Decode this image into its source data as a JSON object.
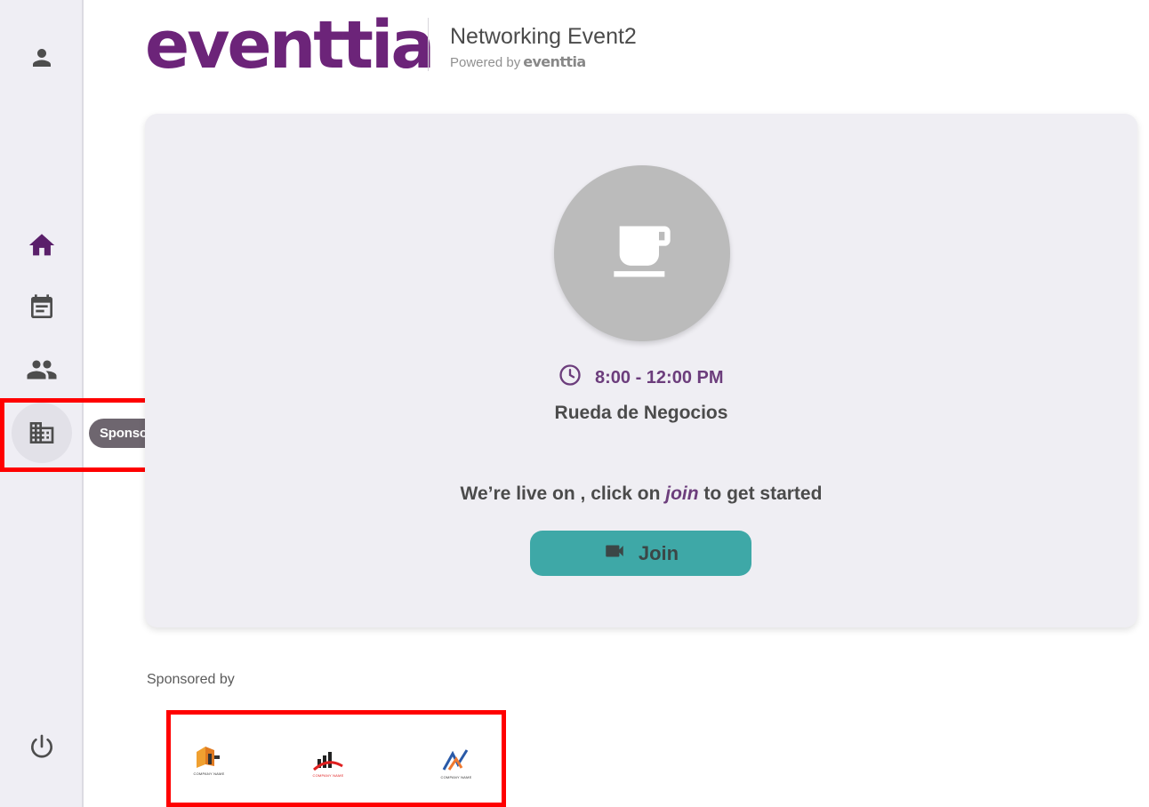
{
  "sidebar": {
    "items": [
      {
        "name": "profile",
        "icon": "person-icon"
      },
      {
        "name": "home",
        "icon": "home-icon"
      },
      {
        "name": "agenda",
        "icon": "calendar-icon"
      },
      {
        "name": "networking",
        "icon": "people-icon"
      },
      {
        "name": "sponsors",
        "icon": "building-icon"
      },
      {
        "name": "logout",
        "icon": "power-icon"
      }
    ],
    "tooltip": "Sponsors"
  },
  "header": {
    "logo_text": "eventtia",
    "event_title": "Networking Event2",
    "powered_by": "Powered by",
    "powered_logo": "eventtia"
  },
  "session": {
    "time": "8:00 - 12:00 PM",
    "title": "Rueda de Negocios",
    "live_prefix": "We’re live on , click on ",
    "live_join_word": "join",
    "live_suffix": " to get started",
    "join_label": "Join"
  },
  "sponsors": {
    "heading": "Sponsored by",
    "logos": [
      {
        "caption": "COMPANY NAME"
      },
      {
        "caption": "COMPANY NAME"
      },
      {
        "caption": "COMPANY NAME"
      }
    ]
  },
  "colors": {
    "brand_purple": "#6c2479",
    "accent_teal": "#3ea8a7",
    "highlight_red": "#ff0000"
  }
}
